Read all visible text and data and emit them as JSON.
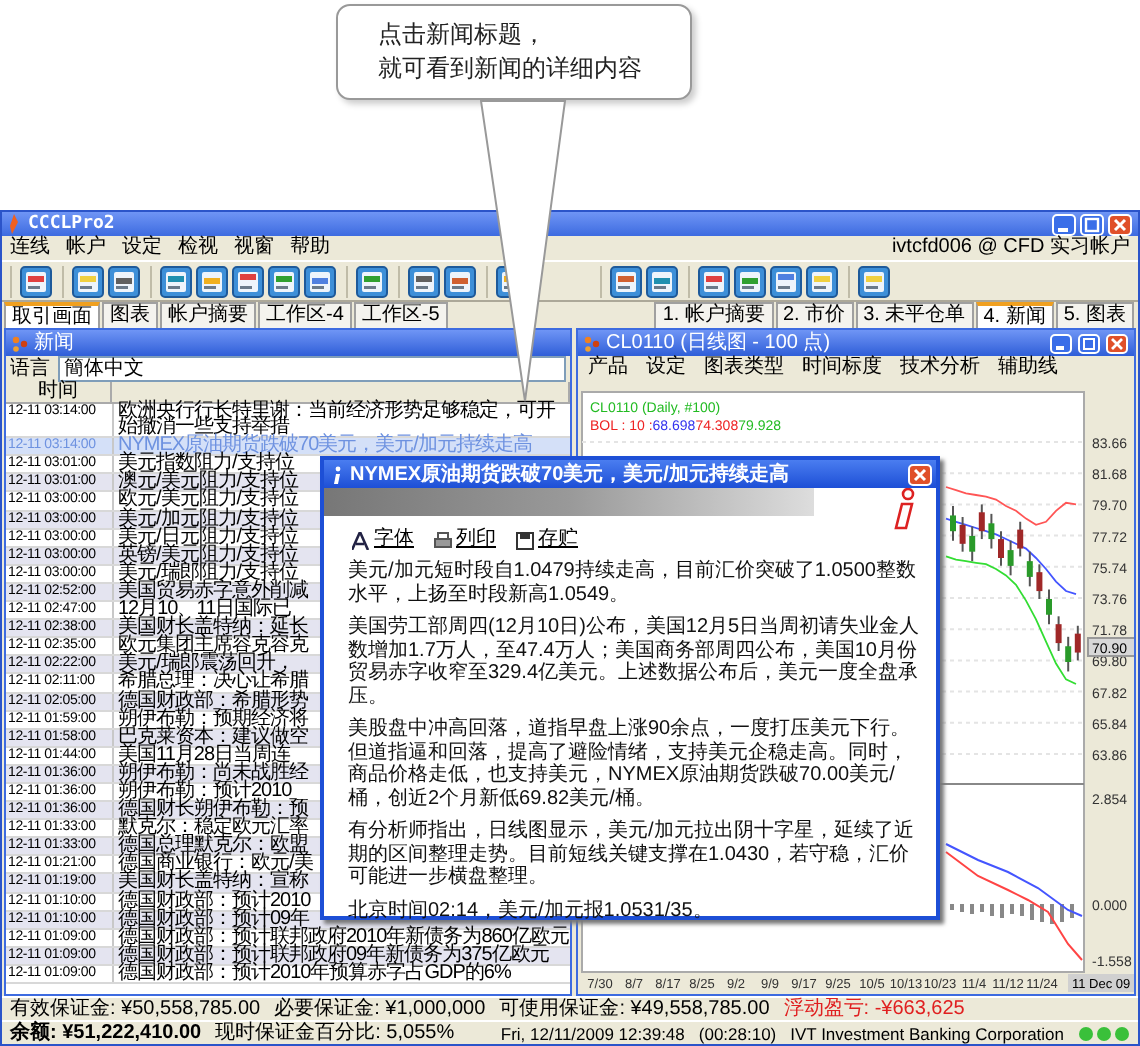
{
  "callout": {
    "lines": [
      "点击新闻标题，",
      "就可看到新闻的详细内容"
    ]
  },
  "window": {
    "title": "CCCLPro2"
  },
  "menu": [
    "连线",
    "帐户",
    "设定",
    "检视",
    "视窗",
    "帮助"
  ],
  "account": "ivtcfd006 @ CFD 实习帐户",
  "workspace_tabs": [
    {
      "label": "取引画面",
      "selected": true
    },
    {
      "label": "图表",
      "selected": false
    },
    {
      "label": "帐户摘要",
      "selected": false
    },
    {
      "label": "工作区-4",
      "selected": false
    },
    {
      "label": "工作区-5",
      "selected": false
    }
  ],
  "panel_tabs": [
    {
      "label": "1. 帐户摘要",
      "selected": false
    },
    {
      "label": "2. 市价",
      "selected": false
    },
    {
      "label": "3. 未平仓单",
      "selected": false
    },
    {
      "label": "4. 新闻",
      "selected": true
    },
    {
      "label": "5. 图表",
      "selected": false
    }
  ],
  "news_window": {
    "title": "新闻",
    "language_label": "语言",
    "language": "簡体中文",
    "column_time": "时间",
    "rows": [
      {
        "time": "12-11 03:14:00",
        "title": "欧洲央行行长特里谢：当前经济形势足够稳定，可开始撤消一些支持举措",
        "selected": false
      },
      {
        "time": "12-11 03:14:00",
        "title": "NYMEX原油期货跌破70美元，美元/加元持续走高",
        "selected": true
      },
      {
        "time": "12-11 03:01:00",
        "title": "美元指数阻力/支持位",
        "selected": false
      },
      {
        "time": "12-11 03:01:00",
        "title": "澳元/美元阻力/支持位",
        "selected": false
      },
      {
        "time": "12-11 03:00:00",
        "title": "欧元/美元阻力/支持位",
        "selected": false
      },
      {
        "time": "12-11 03:00:00",
        "title": "美元/加元阻力/支持位",
        "selected": false
      },
      {
        "time": "12-11 03:00:00",
        "title": "美元/日元阻力/支持位",
        "selected": false
      },
      {
        "time": "12-11 03:00:00",
        "title": "英镑/美元阻力/支持位",
        "selected": false
      },
      {
        "time": "12-11 03:00:00",
        "title": "美元/瑞郎阻力/支持位",
        "selected": false
      },
      {
        "time": "12-11 02:52:00",
        "title": "美国贸易赤字意外削减",
        "selected": false
      },
      {
        "time": "12-11 02:47:00",
        "title": "12月10、11日国际已",
        "selected": false
      },
      {
        "time": "12-11 02:38:00",
        "title": "美国财长盖特纳：延长",
        "selected": false
      },
      {
        "time": "12-11 02:35:00",
        "title": "欧元集团主席容克容克",
        "selected": false
      },
      {
        "time": "12-11 02:22:00",
        "title": "美元/瑞郎震荡回升，",
        "selected": false
      },
      {
        "time": "12-11 02:11:00",
        "title": "希腊总理：决心让希腊",
        "selected": false
      },
      {
        "time": "12-11 02:05:00",
        "title": "德国财政部：希腊形势",
        "selected": false
      },
      {
        "time": "12-11 01:59:00",
        "title": "朔伊布勒：预期经济将",
        "selected": false
      },
      {
        "time": "12-11 01:58:00",
        "title": "巴克莱资本：建议做空",
        "selected": false
      },
      {
        "time": "12-11 01:44:00",
        "title": "美国11月28日当周连",
        "selected": false
      },
      {
        "time": "12-11 01:36:00",
        "title": "朔伊布勒：尚未战胜经",
        "selected": false
      },
      {
        "time": "12-11 01:36:00",
        "title": "朔伊布勒：预计2010",
        "selected": false
      },
      {
        "time": "12-11 01:36:00",
        "title": "德国财长朔伊布勒：预",
        "selected": false
      },
      {
        "time": "12-11 01:33:00",
        "title": "默克尔：稳定欧元汇率",
        "selected": false
      },
      {
        "time": "12-11 01:33:00",
        "title": "德国总理默克尔：欧盟",
        "selected": false
      },
      {
        "time": "12-11 01:21:00",
        "title": "德国商业银行：欧元/美",
        "selected": false
      },
      {
        "time": "12-11 01:19:00",
        "title": "美国财长盖特纳：宣称",
        "selected": false
      },
      {
        "time": "12-11 01:10:00",
        "title": "德国财政部：预计2010",
        "selected": false
      },
      {
        "time": "12-11 01:10:00",
        "title": "德国财政部：预计09年",
        "selected": false
      },
      {
        "time": "12-11 01:09:00",
        "title": "德国财政部：预计联邦政府2010年新债务为860亿欧元",
        "selected": false
      },
      {
        "time": "12-11 01:09:00",
        "title": "德国财政部：预计联邦政府09年新债务为375亿欧元",
        "selected": false
      },
      {
        "time": "12-11 01:09:00",
        "title": "德国财政部：预计2010年预算赤字占GDP的6%",
        "selected": false
      }
    ]
  },
  "chart_window": {
    "title": "CL0110 (日线图 - 100 点)",
    "menu": [
      "产品",
      "设定",
      "图表类型",
      "时间标度",
      "技术分析",
      "辅助线"
    ],
    "legend": "CL0110 (Daily, #100)",
    "bol_label": "BOL : 10 :",
    "bol_values": [
      {
        "text": "68.698",
        "color": "#3333ee"
      },
      {
        "text": "74.308",
        "color": "#ee2222"
      },
      {
        "text": "79.928",
        "color": "#22bb22"
      }
    ],
    "y_labels": [
      "83.66",
      "81.68",
      "79.70",
      "77.72",
      "75.74",
      "73.76",
      "71.78",
      "69.80",
      "67.82",
      "65.84",
      "63.86"
    ],
    "current_price": "70.90",
    "macd_labels": [
      "2.854",
      "0.000",
      "-1.558"
    ],
    "x_labels": [
      "7/30",
      "8/7",
      "8/17",
      "8/25",
      "9/2",
      "9/9",
      "9/17",
      "9/25",
      "10/5",
      "10/13",
      "10/23",
      "11/4",
      "11/12",
      "11/24"
    ],
    "current_date": "11 Dec 09"
  },
  "news_popup": {
    "title": "NYMEX原油期货跌破70美元，美元/加元持续走高",
    "tools": [
      "字体",
      "列印",
      "存贮"
    ],
    "paragraphs": [
      "美元/加元短时段自1.0479持续走高，目前汇价突破了1.0500整数水平，上扬至时段新高1.0549。",
      "美国劳工部周四(12月10日)公布，美国12月5日当周初请失业金人数增加1.7万人，至47.4万人；美国商务部周四公布，美国10月份贸易赤字收窄至329.4亿美元。上述数据公布后，美元一度全盘承压。",
      "美股盘中冲高回落，道指早盘上涨90余点，一度打压美元下行。但道指逼和回落，提高了避险情绪，支持美元企稳走高。同时，商品价格走低，也支持美元，NYMEX原油期货跌破70.00美元/桶，创近2个月新低69.82美元/桶。",
      "有分析师指出，日线图显示，美元/加元拉出阴十字星，延续了近期的区间整理走势。目前短线关键支撑在1.0430，若守稳，汇价可能进一步横盘整理。",
      "北京时间02:14，美元/加元报1.0531/35。"
    ]
  },
  "status": {
    "row1": [
      {
        "text": "有效保证金: ¥50,558,785.00",
        "kind": "normal"
      },
      {
        "text": "必要保证金: ¥1,000,000",
        "kind": "normal"
      },
      {
        "text": "可使用保证金: ¥49,558,785.00",
        "kind": "normal"
      },
      {
        "text": "浮动盈亏: -¥663,625",
        "kind": "loss"
      }
    ],
    "balance": "余额: ¥51,222,410.00",
    "margin_ratio": "现时保证金百分比: 5,055%",
    "datetime": "Fri, 12/11/2009 12:39:48",
    "elapsed": "(00:28:10)",
    "company": "IVT Investment Banking Corporation"
  }
}
